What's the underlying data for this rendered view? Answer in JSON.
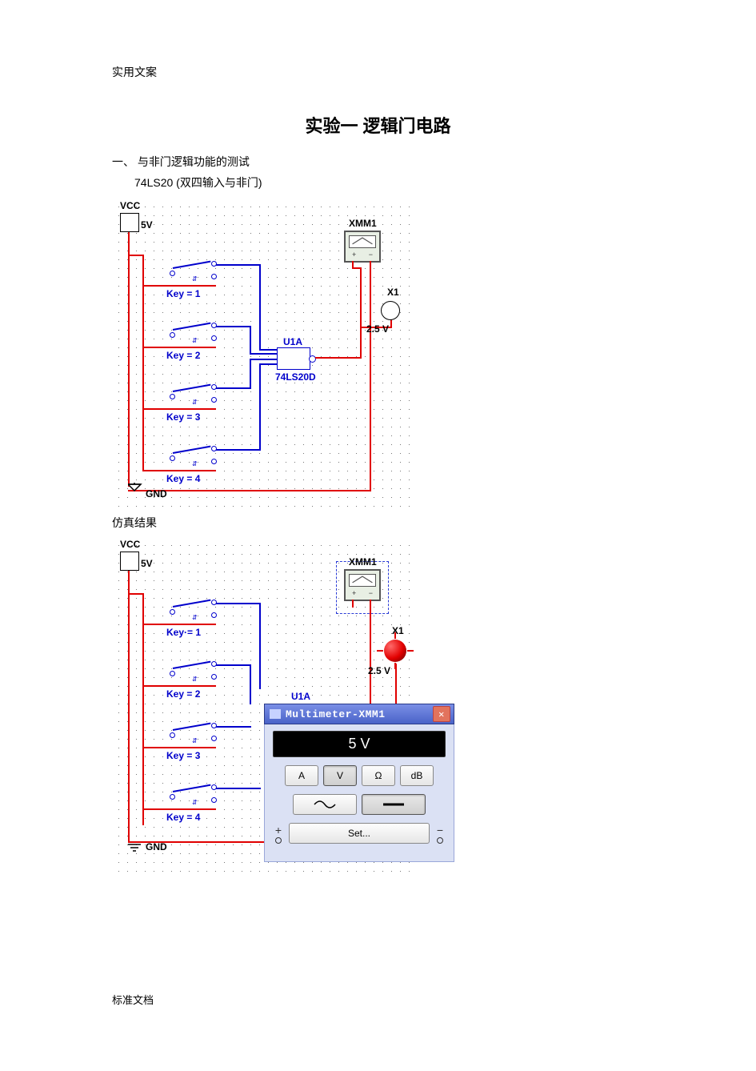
{
  "header": "实用文案",
  "title": "实验一    逻辑门电路",
  "section1_label": "一、 与非门逻辑功能的测试",
  "section1_sub": "74LS20  (双四输入与非门)",
  "result_label": "仿真结果",
  "footer": "标准文档",
  "circuit": {
    "vcc": "VCC",
    "vcc_val": "5V",
    "gnd": "GND",
    "xmm": "XMM1",
    "gate_id": "U1A",
    "gate_part": "74LS20D",
    "probe_id": "X1",
    "probe_val": "2.5 V",
    "keys": [
      "Key = 1",
      "Key = 2",
      "Key = 3",
      "Key = 4"
    ],
    "keys_alt": [
      "Key·= 1",
      "Key = 2",
      "Key = 3",
      "Key = 4"
    ]
  },
  "multimeter": {
    "title": "Multimeter-XMM1",
    "reading": "5 V",
    "buttons_row1": [
      "A",
      "V",
      "Ω",
      "dB"
    ],
    "set_label": "Set...",
    "selected_unit": "V",
    "selected_wave": "dc"
  }
}
